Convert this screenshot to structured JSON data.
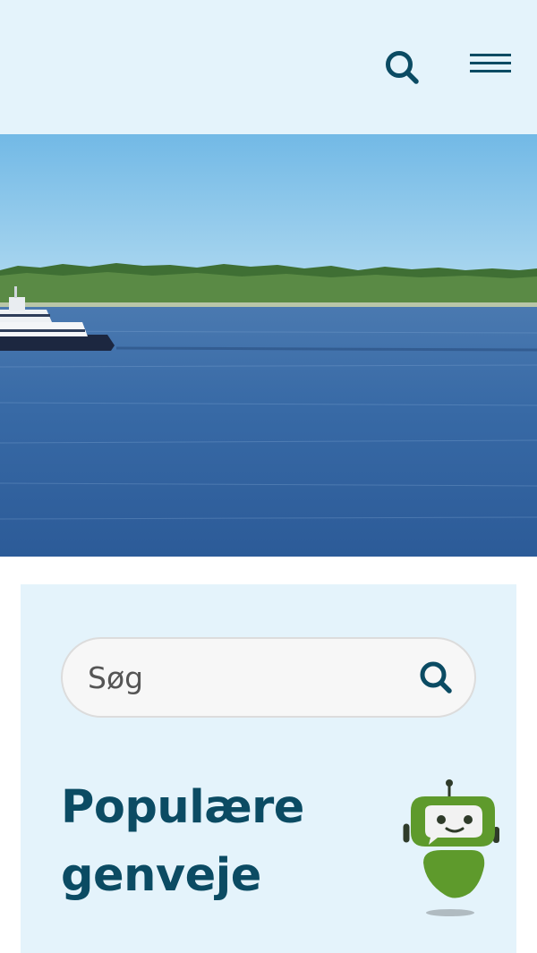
{
  "header": {
    "search_icon": "search-icon",
    "menu_icon": "hamburger-menu-icon"
  },
  "hero": {
    "image": "ferry-on-blue-water-photo"
  },
  "search": {
    "placeholder": "Søg",
    "button_icon": "search-icon"
  },
  "shortcuts": {
    "title": "Populære genveje"
  },
  "assistant": {
    "icon": "chatbot-robot-icon"
  },
  "colors": {
    "header_background": "#e4f3fb",
    "panel_background": "#e4f3fb",
    "primary_dark": "#0b4b63",
    "robot_green": "#5e9a2c"
  }
}
